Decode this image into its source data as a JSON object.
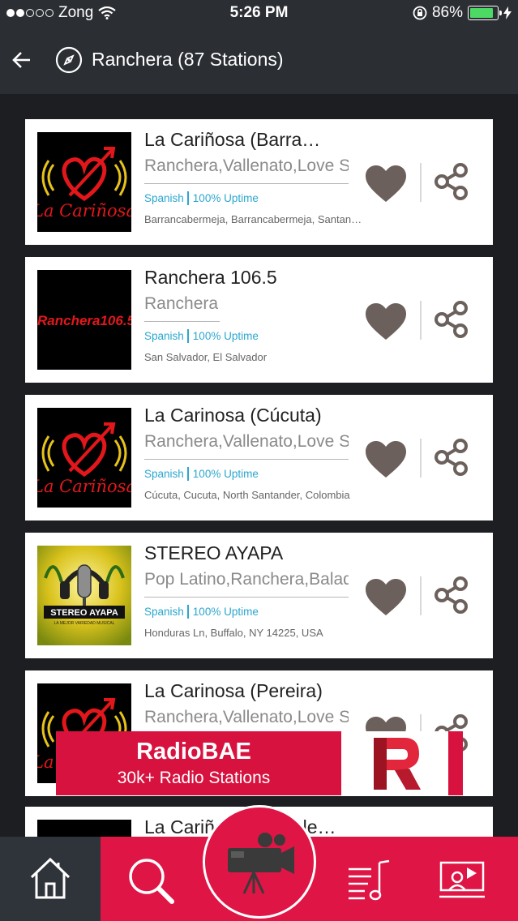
{
  "status_bar": {
    "carrier": "Zong",
    "time": "5:26 PM",
    "battery_percent": "86%",
    "battery_level": 0.86,
    "battery_color": "#4cd964"
  },
  "header": {
    "title": "Ranchera (87 Stations)",
    "back_icon": "back-arrow-icon",
    "compass_icon": "compass-icon"
  },
  "stations": [
    {
      "name": "La Cariñosa (Barra…",
      "genres": "Ranchera,Vallenato,Love Songs",
      "language": "Spanish",
      "uptime": "100% Uptime",
      "location": "Barrancabermeja, Barrancabermeja, Santander, Colombia",
      "logo_type": "carinosa",
      "logo_text": "La Cariñosa"
    },
    {
      "name": "Ranchera 106.5",
      "genres": "Ranchera",
      "language": "Spanish",
      "uptime": "100% Uptime",
      "location": "San Salvador, El Salvador",
      "logo_type": "ranchera",
      "logo_text": "Ranchera106.5"
    },
    {
      "name": "La Carinosa (Cúcuta)",
      "genres": "Ranchera,Vallenato,Love Songs",
      "language": "Spanish",
      "uptime": "100% Uptime",
      "location": "Cúcuta, Cucuta, North Santander, Colombia",
      "logo_type": "carinosa",
      "logo_text": "La Cariñosa"
    },
    {
      "name": "STEREO AYAPA",
      "genres": "Pop Latino,Ranchera,Balada",
      "language": "Spanish",
      "uptime": "100% Uptime",
      "location": "Honduras Ln, Buffalo, NY 14225, USA",
      "logo_type": "ayapa",
      "logo_text": "STEREO AYAPA",
      "logo_subtext": "LA MEJOR VARIEDAD MUSICAL"
    },
    {
      "name": "La Carinosa (Pereira)",
      "genres": "Ranchera,Vallenato,Love Songs",
      "language": "",
      "uptime": "",
      "location": "",
      "logo_type": "carinosa",
      "logo_text": "La Cariñosa"
    },
    {
      "name": "La Cariñosa (Sincelejo)…",
      "genres": "",
      "language": "",
      "uptime": "",
      "location": "",
      "logo_type": "carinosa",
      "logo_text": ""
    }
  ],
  "ad": {
    "title": "RadioBAE",
    "subtitle": "30k+ Radio Stations",
    "color": "#d8123f"
  },
  "bottom_nav": {
    "items": [
      "home-icon",
      "search-icon",
      "video-camera-icon",
      "playlist-icon",
      "presentation-icon"
    ],
    "accent": "#df1545",
    "home_bg": "#2f343a"
  }
}
